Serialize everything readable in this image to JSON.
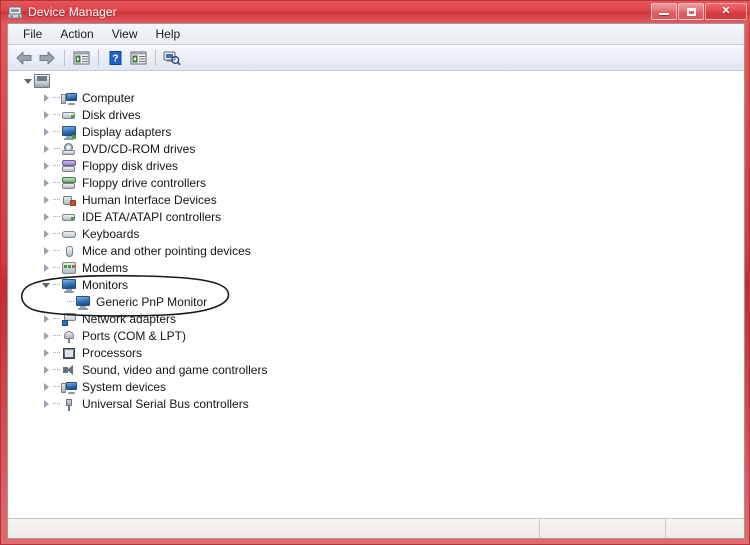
{
  "window": {
    "title": "Device Manager",
    "title_icon": "device-manager-icon",
    "controls": {
      "minimize": "Minimize",
      "maximize": "Maximize",
      "close": "Close",
      "close_glyph": "✕"
    }
  },
  "menu": {
    "items": [
      {
        "label": "File",
        "name": "menu-file"
      },
      {
        "label": "Action",
        "name": "menu-action"
      },
      {
        "label": "View",
        "name": "menu-view"
      },
      {
        "label": "Help",
        "name": "menu-help"
      }
    ]
  },
  "toolbar": {
    "buttons": [
      {
        "name": "back-button",
        "icon": "back-arrow-icon",
        "tooltip": "Back"
      },
      {
        "name": "forward-button",
        "icon": "forward-arrow-icon",
        "tooltip": "Forward"
      },
      {
        "name": "show-hide-console-tree-button",
        "icon": "console-tree-icon",
        "tooltip": "Show/Hide Console Tree"
      },
      {
        "name": "help-button",
        "icon": "help-question-icon",
        "tooltip": "Help"
      },
      {
        "name": "properties-button",
        "icon": "properties-icon",
        "tooltip": "Properties"
      },
      {
        "name": "scan-for-hardware-changes-button",
        "icon": "scan-hardware-icon",
        "tooltip": "Scan for hardware changes"
      }
    ]
  },
  "tree": {
    "root": {
      "name": "tree-root-computer",
      "label": "",
      "icon": "computer-root-icon",
      "expanded": true
    },
    "nodes": [
      {
        "label": "Computer",
        "icon": "computer-icon",
        "expanded": false,
        "level": 1
      },
      {
        "label": "Disk drives",
        "icon": "disk-drive-icon",
        "expanded": false,
        "level": 1
      },
      {
        "label": "Display adapters",
        "icon": "display-adapter-icon",
        "expanded": false,
        "level": 1
      },
      {
        "label": "DVD/CD-ROM drives",
        "icon": "dvd-drive-icon",
        "expanded": false,
        "level": 1
      },
      {
        "label": "Floppy disk drives",
        "icon": "floppy-disk-icon",
        "expanded": false,
        "level": 1
      },
      {
        "label": "Floppy drive controllers",
        "icon": "floppy-controller-icon",
        "expanded": false,
        "level": 1
      },
      {
        "label": "Human Interface Devices",
        "icon": "hid-icon",
        "expanded": false,
        "level": 1
      },
      {
        "label": "IDE ATA/ATAPI controllers",
        "icon": "ide-controller-icon",
        "expanded": false,
        "level": 1
      },
      {
        "label": "Keyboards",
        "icon": "keyboard-icon",
        "expanded": false,
        "level": 1
      },
      {
        "label": "Mice and other pointing devices",
        "icon": "mouse-icon",
        "expanded": false,
        "level": 1
      },
      {
        "label": "Modems",
        "icon": "modem-icon",
        "expanded": false,
        "level": 1
      },
      {
        "label": "Monitors",
        "icon": "monitor-icon",
        "expanded": true,
        "level": 1
      },
      {
        "label": "Generic PnP Monitor",
        "icon": "monitor-icon",
        "expanded": null,
        "level": 2
      },
      {
        "label": "Network adapters",
        "icon": "network-adapter-icon",
        "expanded": false,
        "level": 1
      },
      {
        "label": "Ports (COM & LPT)",
        "icon": "port-icon",
        "expanded": false,
        "level": 1
      },
      {
        "label": "Processors",
        "icon": "processor-icon",
        "expanded": false,
        "level": 1
      },
      {
        "label": "Sound, video and game controllers",
        "icon": "sound-controller-icon",
        "expanded": false,
        "level": 1
      },
      {
        "label": "System devices",
        "icon": "system-device-icon",
        "expanded": false,
        "level": 1
      },
      {
        "label": "Universal Serial Bus controllers",
        "icon": "usb-controller-icon",
        "expanded": false,
        "level": 1
      }
    ]
  },
  "annotation": {
    "name": "highlight-ellipse",
    "shape": "ellipse",
    "color": "#1a1a1a",
    "targets": "Monitors / Generic PnP Monitor"
  },
  "statusbar": {
    "panes": [
      "",
      "",
      ""
    ]
  },
  "colors": {
    "titlebar_red": "#dd4348",
    "frame_red": "#c9292f",
    "menubar": "#e6ecf6",
    "content_bg": "#ffffff",
    "annotation": "#1a1a1a"
  }
}
